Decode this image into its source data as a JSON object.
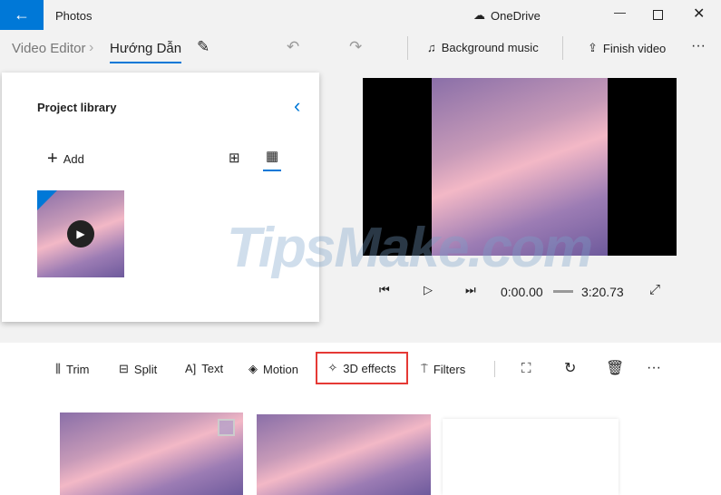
{
  "app_title": "Photos",
  "onedrive": "OneDrive",
  "breadcrumb": {
    "root": "Video Editor",
    "current": "Hướng Dẫn"
  },
  "header": {
    "background_music": "Background music",
    "finish_video": "Finish video"
  },
  "library": {
    "title": "Project library",
    "add": "Add"
  },
  "player": {
    "current_time": "0:00.00",
    "total_time": "3:20.73"
  },
  "toolbar": {
    "trim": "Trim",
    "split": "Split",
    "text": "Text",
    "motion": "Motion",
    "effects3d": "3D effects",
    "filters": "Filters"
  },
  "watermark": "TipsMake.com",
  "colors": {
    "accent": "#0078d7",
    "highlight": "#e53935"
  }
}
